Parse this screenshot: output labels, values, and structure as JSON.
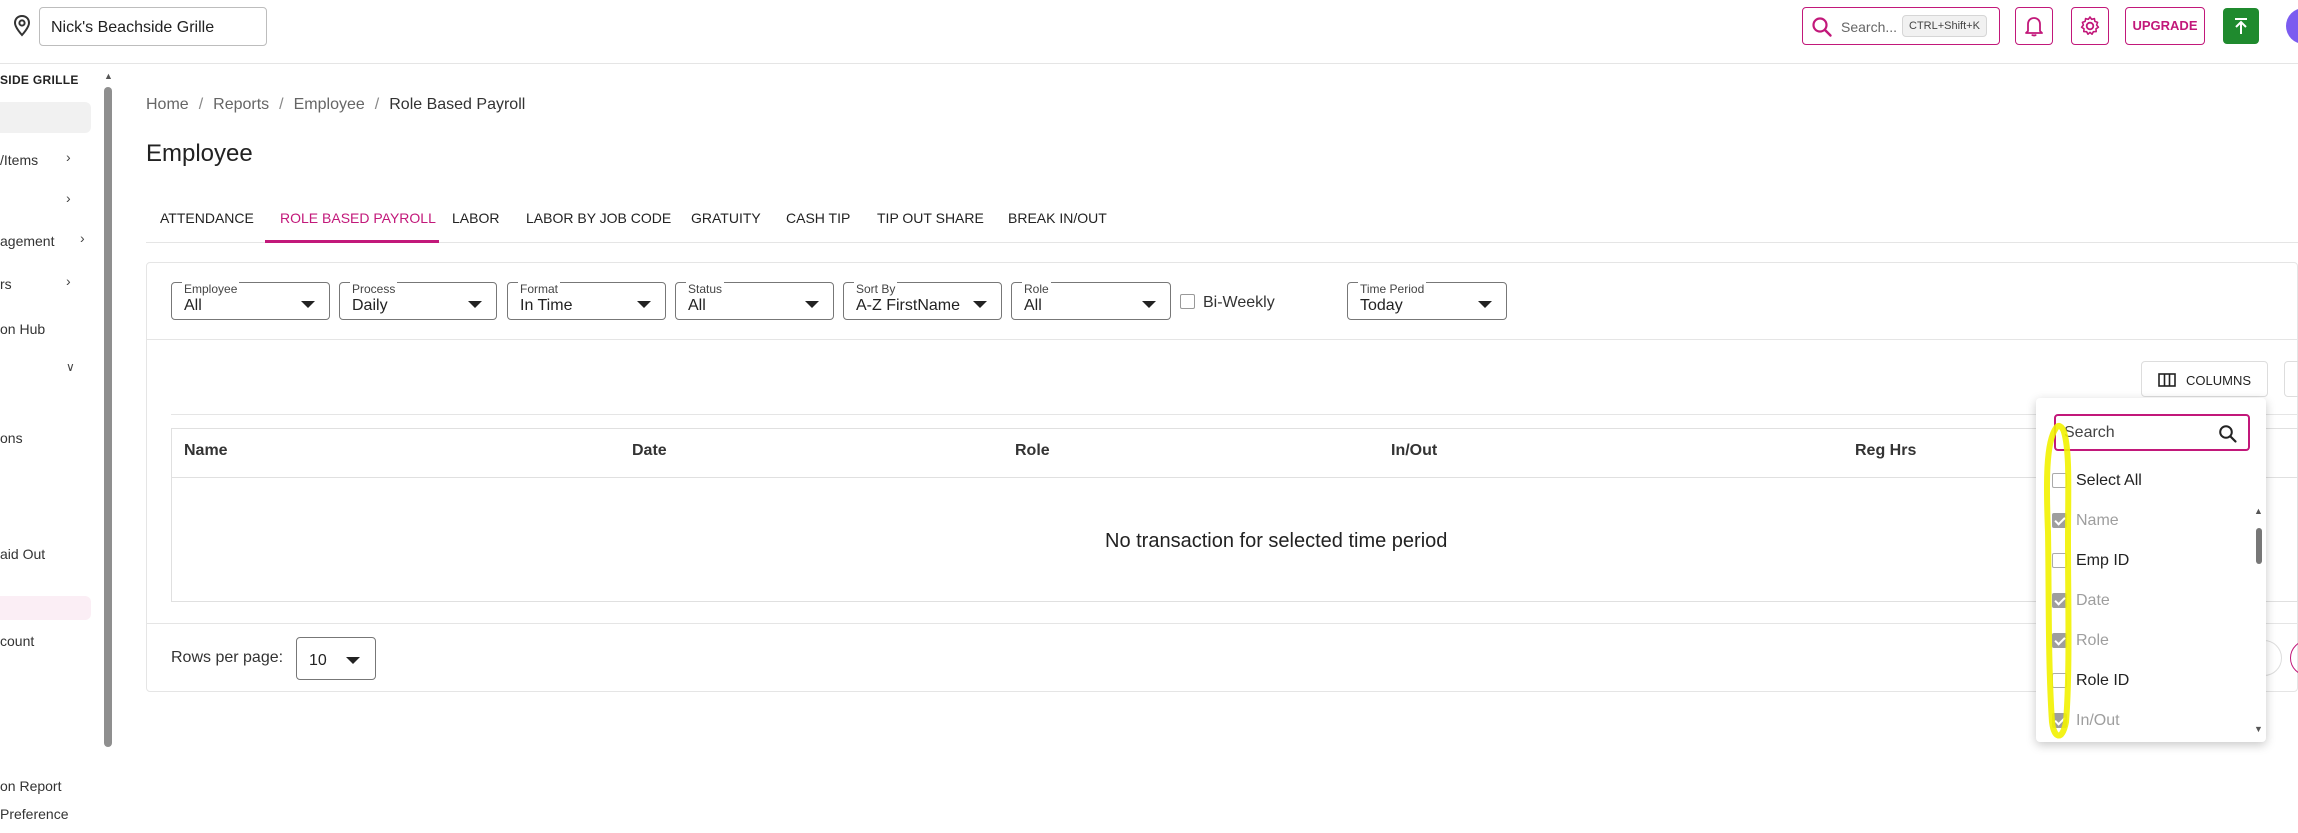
{
  "topbar": {
    "location": "Nick's Beachside Grille",
    "search_placeholder": "Search...",
    "search_shortcut": "CTRL+Shift+K",
    "upgrade_label": "UPGRADE"
  },
  "sidebar": {
    "title": "SIDE GRILLE",
    "items": [
      "/Items",
      "agement",
      "rs",
      "on Hub",
      "ons",
      "aid Out",
      "count",
      "on Report",
      "Preference"
    ]
  },
  "breadcrumb": [
    "Home",
    "Reports",
    "Employee",
    "Role Based Payroll"
  ],
  "page_title": "Employee",
  "tabs": [
    "ATTENDANCE",
    "ROLE BASED PAYROLL",
    "LABOR",
    "LABOR BY JOB CODE",
    "GRATUITY",
    "CASH TIP",
    "TIP OUT SHARE",
    "BREAK IN/OUT"
  ],
  "active_tab": "ROLE BASED PAYROLL",
  "filters": [
    {
      "label": "Employee",
      "value": "All"
    },
    {
      "label": "Process",
      "value": "Daily"
    },
    {
      "label": "Format",
      "value": "In Time"
    },
    {
      "label": "Status",
      "value": "All"
    },
    {
      "label": "Sort By",
      "value": "A-Z FirstName"
    },
    {
      "label": "Role",
      "value": "All"
    },
    {
      "label": "Time Period",
      "value": "Today"
    }
  ],
  "biweekly_label": "Bi-Weekly",
  "columns_button": "COLUMNS",
  "table": {
    "headers": [
      "Name",
      "Date",
      "Role",
      "In/Out",
      "Reg Hrs"
    ],
    "empty_message": "No transaction for selected time period"
  },
  "pagination": {
    "rows_per_page_label": "Rows per page:",
    "rows_per_page": "10"
  },
  "columns_panel": {
    "search_placeholder": "Search",
    "items": [
      {
        "label": "Select All",
        "checked": false,
        "disabled": false
      },
      {
        "label": "Name",
        "checked": true,
        "disabled": true
      },
      {
        "label": "Emp ID",
        "checked": false,
        "disabled": false
      },
      {
        "label": "Date",
        "checked": true,
        "disabled": true
      },
      {
        "label": "Role",
        "checked": true,
        "disabled": true
      },
      {
        "label": "Role ID",
        "checked": false,
        "disabled": false
      },
      {
        "label": "In/Out",
        "checked": true,
        "disabled": true
      }
    ]
  },
  "colors": {
    "accent": "#c2187a",
    "green": "#1f8a2e",
    "highlighter": "#f2f200"
  }
}
